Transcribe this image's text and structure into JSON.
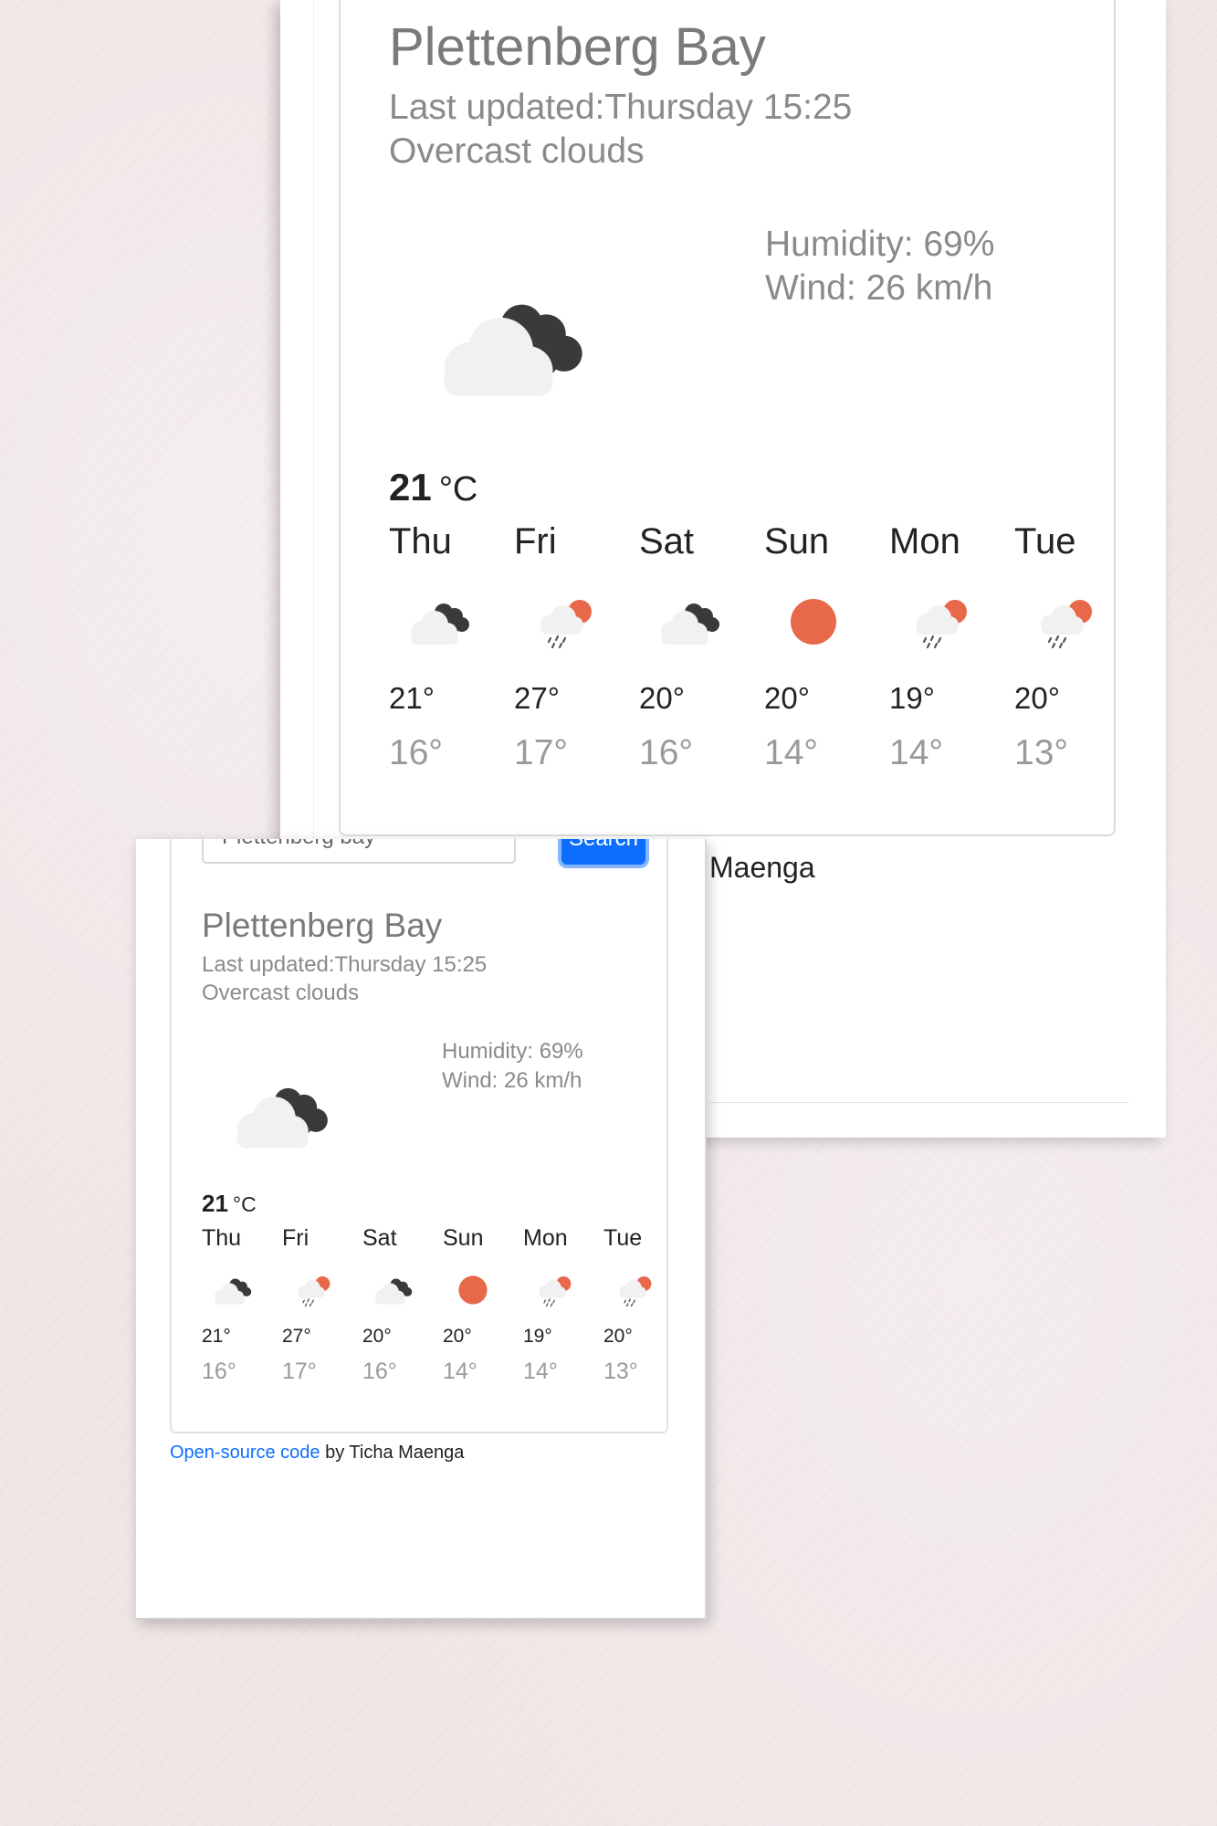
{
  "colors": {
    "accent": "#0d6efd",
    "sun": "#e8684a",
    "cloud_dark": "#3a3a3a",
    "cloud_light": "#f1f1f1",
    "muted_text": "#8a8a8a"
  },
  "large_view": {
    "city": "Plettenberg Bay",
    "last_updated": "Last updated:Thursday 15:25",
    "description": "Overcast clouds",
    "humidity": "Humidity: 69%",
    "wind": "Wind: 26 km/h",
    "main_icon": "overcast-clouds-icon",
    "temperature": "21",
    "unit": "°C",
    "forecast": [
      {
        "day": "Thu",
        "icon": "broken-clouds-icon",
        "high": "21°",
        "low": "16°"
      },
      {
        "day": "Fri",
        "icon": "sun-rain-icon",
        "high": "27°",
        "low": "17°"
      },
      {
        "day": "Sat",
        "icon": "broken-clouds-icon",
        "high": "20°",
        "low": "16°"
      },
      {
        "day": "Sun",
        "icon": "sun-icon",
        "high": "20°",
        "low": "14°"
      },
      {
        "day": "Mon",
        "icon": "sun-rain-icon",
        "high": "19°",
        "low": "14°"
      },
      {
        "day": "Tue",
        "icon": "sun-rain-icon",
        "high": "20°",
        "low": "13°"
      }
    ],
    "footer_fragment": "Maenga"
  },
  "small_view": {
    "search_value": "Plettenberg bay",
    "search_button": "Search",
    "city": "Plettenberg Bay",
    "last_updated": "Last updated:Thursday 15:25",
    "description": "Overcast clouds",
    "humidity": "Humidity: 69%",
    "wind": "Wind: 26 km/h",
    "main_icon": "overcast-clouds-icon",
    "temperature": "21",
    "unit": "°C",
    "forecast": [
      {
        "day": "Thu",
        "icon": "broken-clouds-icon",
        "high": "21°",
        "low": "16°"
      },
      {
        "day": "Fri",
        "icon": "sun-rain-icon",
        "high": "27°",
        "low": "17°"
      },
      {
        "day": "Sat",
        "icon": "broken-clouds-icon",
        "high": "20°",
        "low": "16°"
      },
      {
        "day": "Sun",
        "icon": "sun-icon",
        "high": "20°",
        "low": "14°"
      },
      {
        "day": "Mon",
        "icon": "sun-rain-icon",
        "high": "19°",
        "low": "14°"
      },
      {
        "day": "Tue",
        "icon": "sun-rain-icon",
        "high": "20°",
        "low": "13°"
      }
    ],
    "footer": {
      "link_text": "Open-source code",
      "by_text": " by Ticha Maenga"
    }
  }
}
